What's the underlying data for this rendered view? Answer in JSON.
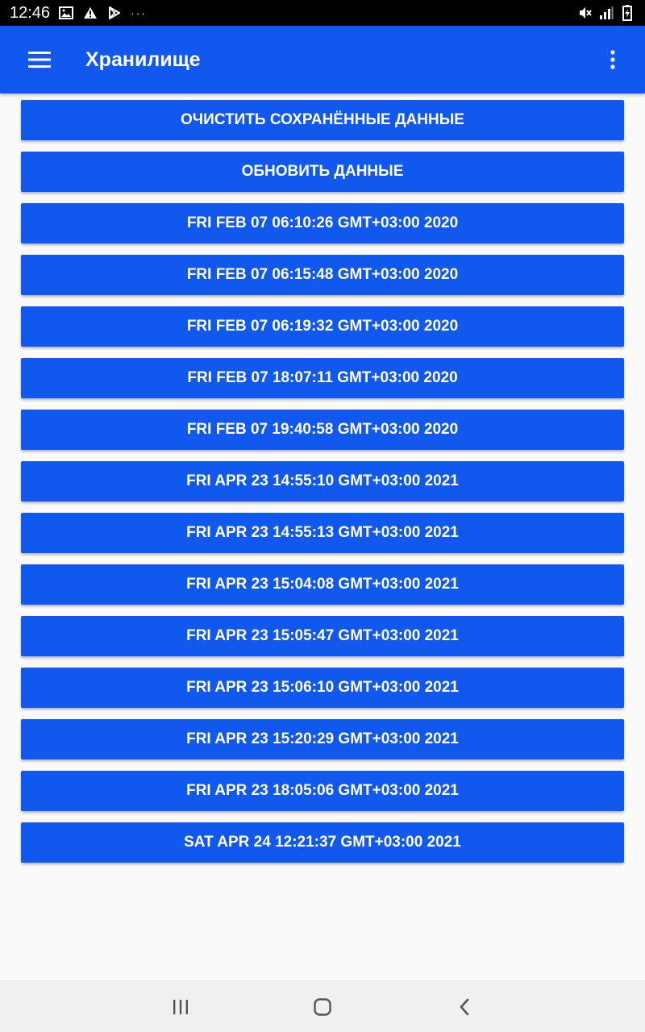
{
  "status_bar": {
    "time": "12:46",
    "more_indicator": "···",
    "icons": [
      "image-icon",
      "warning-icon",
      "play-store-icon",
      "mute-icon",
      "signal-icon",
      "battery-icon"
    ]
  },
  "app_bar": {
    "title": "Хранилище",
    "color": "#1158ee"
  },
  "actions": {
    "clear_label": "ОЧИСТИТЬ СОХРАНЁННЫЕ ДАННЫЕ",
    "refresh_label": "ОБНОВИТЬ ДАННЫЕ"
  },
  "entries": [
    "FRI FEB 07 06:10:26 GMT+03:00 2020",
    "FRI FEB 07 06:15:48 GMT+03:00 2020",
    "FRI FEB 07 06:19:32 GMT+03:00 2020",
    "FRI FEB 07 18:07:11 GMT+03:00 2020",
    "FRI FEB 07 19:40:58 GMT+03:00 2020",
    "FRI APR 23 14:55:10 GMT+03:00 2021",
    "FRI APR 23 14:55:13 GMT+03:00 2021",
    "FRI APR 23 15:04:08 GMT+03:00 2021",
    "FRI APR 23 15:05:47 GMT+03:00 2021",
    "FRI APR 23 15:06:10 GMT+03:00 2021",
    "FRI APR 23 15:20:29 GMT+03:00 2021",
    "FRI APR 23 18:05:06 GMT+03:00 2021",
    "SAT APR 24 12:21:37 GMT+03:00 2021"
  ]
}
